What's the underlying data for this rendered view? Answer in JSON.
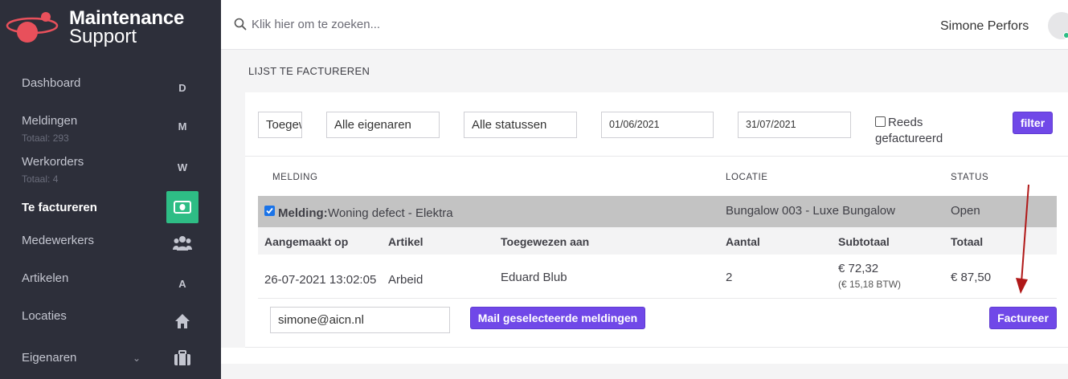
{
  "app": {
    "logo_title": "Maintenance",
    "logo_subtitle": "Support"
  },
  "sidebar": {
    "items": [
      {
        "label": "Dashboard",
        "icon_letter": "D",
        "sub": ""
      },
      {
        "label": "Meldingen",
        "icon_letter": "M",
        "sub": "Totaal: 293"
      },
      {
        "label": "Werkorders",
        "icon_letter": "W",
        "sub": "Totaal: 4"
      },
      {
        "label": "Te factureren",
        "icon": "money-icon",
        "sub": "",
        "active": true
      },
      {
        "label": "Medewerkers",
        "icon": "users-icon",
        "sub": ""
      },
      {
        "label": "Artikelen",
        "icon_letter": "A",
        "sub": ""
      },
      {
        "label": "Locaties",
        "icon": "home-icon",
        "sub": ""
      },
      {
        "label": "Eigenaren",
        "icon": "briefcase-icon",
        "sub": "",
        "expandable": true
      }
    ]
  },
  "header": {
    "search_placeholder": "Klik hier om te zoeken...",
    "user_name": "Simone Perfors"
  },
  "page": {
    "title": "LIJST TE FACTUREREN"
  },
  "filters": {
    "assigned_value": "Toegewezen aan",
    "owners_value": "Alle eigenaren",
    "status_value": "Alle statussen",
    "date_from": "01/06/2021",
    "date_to": "31/07/2021",
    "already_invoiced_label_1": "Reeds",
    "already_invoiced_label_2": "gefactureerd",
    "filter_button": "filter"
  },
  "table": {
    "headers": {
      "melding": "MELDING",
      "locatie": "LOCATIE",
      "status": "STATUS"
    },
    "row": {
      "prefix": "Melding:",
      "title": "Woning defect - Elektra",
      "location": "Bungalow 003 - Luxe Bungalow",
      "status": "Open"
    },
    "sub_headers": {
      "created": "Aangemaakt op",
      "article": "Artikel",
      "assigned": "Toegewezen aan",
      "amount": "Aantal",
      "subtotal": "Subtotaal",
      "total": "Totaal"
    },
    "line": {
      "created": "26-07-2021 13:02:05",
      "article": "Arbeid",
      "assigned": "Eduard Blub",
      "amount": "2",
      "subtotal": "€ 72,32",
      "vat": "(€ 15,18 BTW)",
      "total": "€ 87,50"
    }
  },
  "actions": {
    "email_value": "simone@aicn.nl",
    "mail_button": "Mail geselecteerde meldingen",
    "invoice_button": "Factureer"
  },
  "colors": {
    "sidebar_bg": "#2d2f3a",
    "accent": "#7048e8",
    "active_green": "#2ebd85",
    "arrow": "#b01818"
  }
}
